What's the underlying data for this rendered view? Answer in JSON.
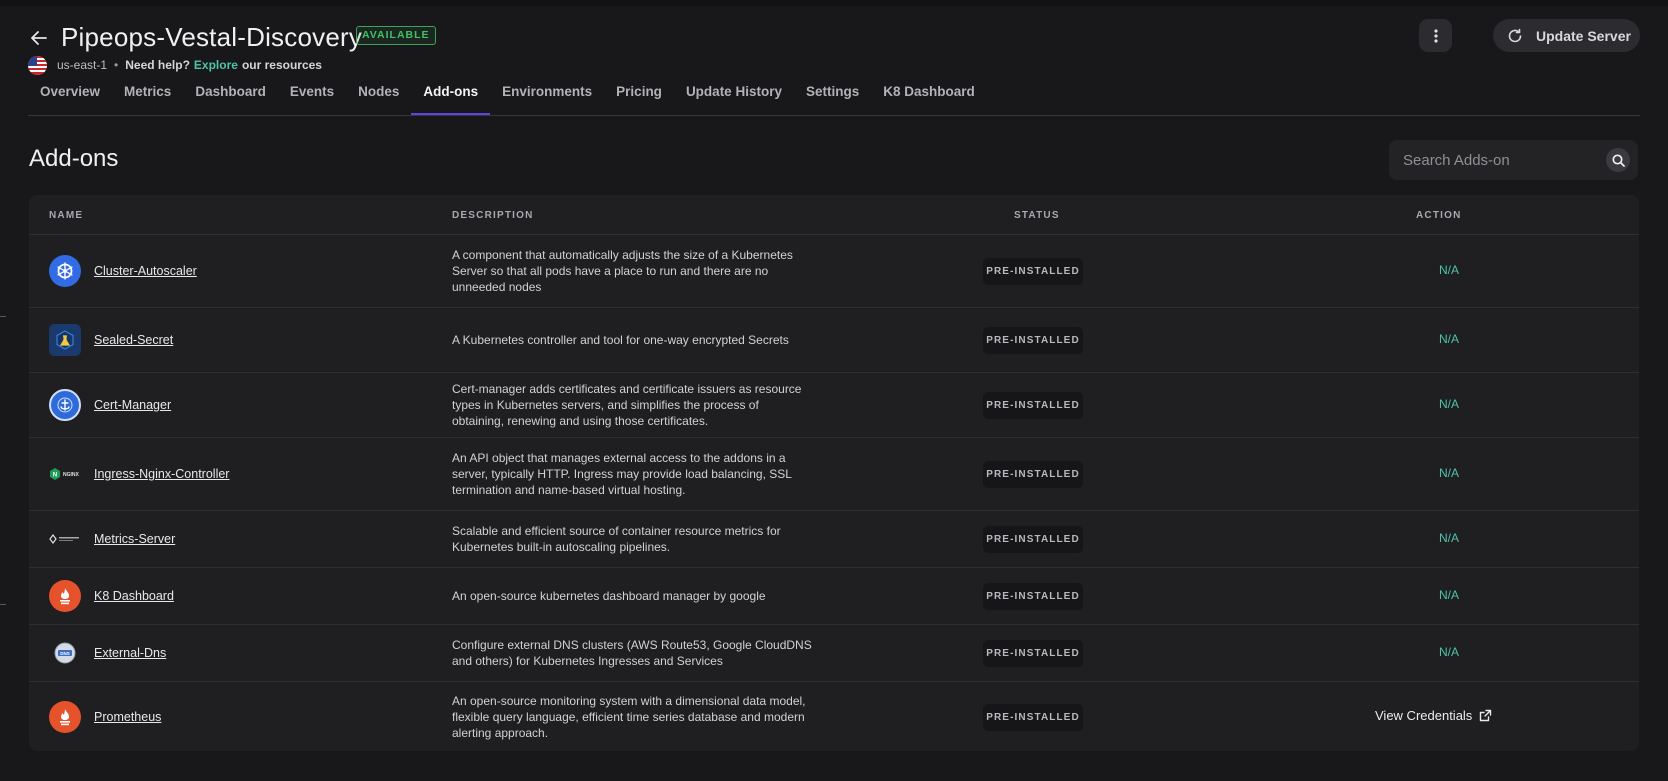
{
  "header": {
    "title": "Pipeops-Vestal-Discovery",
    "status_badge": "AVAILABLE",
    "region": "us-east-1",
    "help_text": "Need help?",
    "explore_link": "Explore",
    "explore_rest": "our resources",
    "update_button": "Update Server",
    "accent_color": "#4ec3a9",
    "badge_color": "#43c164"
  },
  "tabs": [
    {
      "label": "Overview",
      "active": false
    },
    {
      "label": "Metrics",
      "active": false
    },
    {
      "label": "Dashboard",
      "active": false
    },
    {
      "label": "Events",
      "active": false
    },
    {
      "label": "Nodes",
      "active": false
    },
    {
      "label": "Add-ons",
      "active": true
    },
    {
      "label": "Environments",
      "active": false
    },
    {
      "label": "Pricing",
      "active": false
    },
    {
      "label": "Update History",
      "active": false
    },
    {
      "label": "Settings",
      "active": false
    },
    {
      "label": "K8 Dashboard",
      "active": false
    }
  ],
  "section": {
    "title": "Add-ons",
    "search_placeholder": "Search Adds-on"
  },
  "table": {
    "columns": {
      "name": "NAME",
      "description": "DESCRIPTION",
      "status": "STATUS",
      "action": "ACTION"
    },
    "rows": [
      {
        "name": "Cluster-Autoscaler",
        "icon": "kubernetes-wheel-icon",
        "description": "A component that automatically adjusts the size of a Kubernetes Server so that all pods have a place to run and there are no unneeded nodes",
        "status": "PRE-INSTALLED",
        "action": "N/A"
      },
      {
        "name": "Sealed-Secret",
        "icon": "sealed-secret-icon",
        "description": "A Kubernetes controller and tool for one-way encrypted Secrets",
        "status": "PRE-INSTALLED",
        "action": "N/A"
      },
      {
        "name": "Cert-Manager",
        "icon": "cert-manager-icon",
        "description": "Cert-manager adds certificates and certificate issuers as resource types in Kubernetes servers, and simplifies the process of obtaining, renewing and using those certificates.",
        "status": "PRE-INSTALLED",
        "action": "N/A"
      },
      {
        "name": "Ingress-Nginx-Controller",
        "icon": "nginx-icon",
        "description": "An API object that manages external access to the addons in a server, typically HTTP. Ingress may provide load balancing, SSL termination and name-based virtual hosting.",
        "status": "PRE-INSTALLED",
        "action": "N/A"
      },
      {
        "name": "Metrics-Server",
        "icon": "metrics-server-icon",
        "description": "Scalable and efficient source of container resource metrics for Kubernetes built-in autoscaling pipelines.",
        "status": "PRE-INSTALLED",
        "action": "N/A"
      },
      {
        "name": "K8 Dashboard",
        "icon": "prometheus-flame-icon",
        "description": "An open-source kubernetes dashboard manager by google",
        "status": "PRE-INSTALLED",
        "action": "N/A"
      },
      {
        "name": "External-Dns",
        "icon": "external-dns-icon",
        "description": "Configure external DNS clusters (AWS Route53, Google CloudDNS and others) for Kubernetes Ingresses and Services",
        "status": "PRE-INSTALLED",
        "action": "N/A"
      },
      {
        "name": "Prometheus",
        "icon": "prometheus-flame-icon",
        "description": "An open-source monitoring system with a dimensional data model, flexible query language, efficient time series database and modern alerting approach.",
        "status": "PRE-INSTALLED",
        "action": "View Credentials"
      }
    ]
  }
}
